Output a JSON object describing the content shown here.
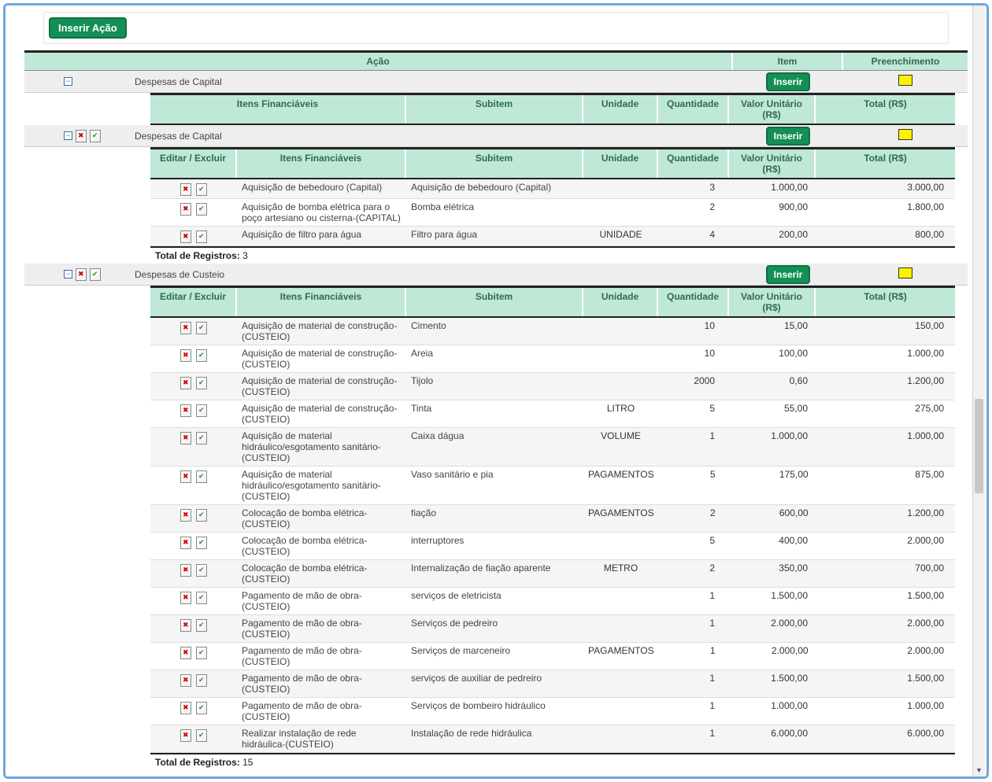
{
  "buttons": {
    "inserir_acao": "Inserir Ação",
    "inserir": "Inserir"
  },
  "headers": {
    "acao": "Ação",
    "item": "Item",
    "preenchimento": "Preenchimento",
    "editar_excluir": "Editar / Excluir",
    "itens_financiaveis": "Itens Financiáveis",
    "subitem": "Subitem",
    "unidade": "Unidade",
    "quantidade": "Quantidade",
    "valor_unitario": "Valor Unitário (R$)",
    "total": "Total (R$)",
    "total_registros": "Total de Registros:"
  },
  "sections": [
    {
      "label": "Despesas de Capital",
      "show_icons": false,
      "rows": [],
      "total": null
    },
    {
      "label": "Despesas de Capital",
      "show_icons": true,
      "rows": [
        {
          "item": "Aquisição de bebedouro (Capital)",
          "sub": "Aquisição de bebedouro (Capital)",
          "unid": "",
          "qtd": "3",
          "valu": "1.000,00",
          "tot": "3.000,00"
        },
        {
          "item": "Aquisição de bomba elétrica para o poço artesiano ou cisterna-(CAPITAL)",
          "sub": "Bomba elétrica",
          "unid": "",
          "qtd": "2",
          "valu": "900,00",
          "tot": "1.800,00"
        },
        {
          "item": "Aquisição de filtro para água",
          "sub": "Filtro para água",
          "unid": "UNIDADE",
          "qtd": "4",
          "valu": "200,00",
          "tot": "800,00"
        }
      ],
      "total": "3"
    },
    {
      "label": "Despesas de Custeio",
      "show_icons": true,
      "rows": [
        {
          "item": "Aquisição de material de construção-(CUSTEIO)",
          "sub": "Cimento",
          "unid": "",
          "qtd": "10",
          "valu": "15,00",
          "tot": "150,00"
        },
        {
          "item": "Aquisição de material de construção-(CUSTEIO)",
          "sub": "Areia",
          "unid": "",
          "qtd": "10",
          "valu": "100,00",
          "tot": "1.000,00"
        },
        {
          "item": "Aquisição de material de construção-(CUSTEIO)",
          "sub": "Tijolo",
          "unid": "",
          "qtd": "2000",
          "valu": "0,60",
          "tot": "1.200,00"
        },
        {
          "item": "Aquisição de material de construção-(CUSTEIO)",
          "sub": "Tinta",
          "unid": "LITRO",
          "qtd": "5",
          "valu": "55,00",
          "tot": "275,00"
        },
        {
          "item": "Aquisição de material hidráulico/esgotamento sanitário-(CUSTEIO)",
          "sub": "Caixa dágua",
          "unid": "VOLUME",
          "qtd": "1",
          "valu": "1.000,00",
          "tot": "1.000,00"
        },
        {
          "item": "Aquisição de material hidráulico/esgotamento sanitário-(CUSTEIO)",
          "sub": "Vaso sanitário e pia",
          "unid": "PAGAMENTOS",
          "qtd": "5",
          "valu": "175,00",
          "tot": "875,00"
        },
        {
          "item": "Colocação de bomba elétrica-(CUSTEIO)",
          "sub": "fiação",
          "unid": "PAGAMENTOS",
          "qtd": "2",
          "valu": "600,00",
          "tot": "1.200,00"
        },
        {
          "item": "Colocação de bomba elétrica-(CUSTEIO)",
          "sub": "interruptores",
          "unid": "",
          "qtd": "5",
          "valu": "400,00",
          "tot": "2.000,00"
        },
        {
          "item": "Colocação de bomba elétrica-(CUSTEIO)",
          "sub": "Internalização de fiação aparente",
          "unid": "METRO",
          "qtd": "2",
          "valu": "350,00",
          "tot": "700,00"
        },
        {
          "item": "Pagamento de mão de obra-(CUSTEIO)",
          "sub": "serviços de eletricista",
          "unid": "",
          "qtd": "1",
          "valu": "1.500,00",
          "tot": "1.500,00"
        },
        {
          "item": "Pagamento de mão de obra-(CUSTEIO)",
          "sub": "Serviços de pedreiro",
          "unid": "",
          "qtd": "1",
          "valu": "2.000,00",
          "tot": "2.000,00"
        },
        {
          "item": "Pagamento de mão de obra-(CUSTEIO)",
          "sub": "Serviços de marceneiro",
          "unid": "PAGAMENTOS",
          "qtd": "1",
          "valu": "2.000,00",
          "tot": "2.000,00"
        },
        {
          "item": "Pagamento de mão de obra-(CUSTEIO)",
          "sub": "serviços de auxiliar de pedreiro",
          "unid": "",
          "qtd": "1",
          "valu": "1.500,00",
          "tot": "1.500,00"
        },
        {
          "item": "Pagamento de mão de obra-(CUSTEIO)",
          "sub": "Serviços de bombeiro hidráulico",
          "unid": "",
          "qtd": "1",
          "valu": "1.000,00",
          "tot": "1.000,00"
        },
        {
          "item": "Realizar instalação de rede hidráulica-(CUSTEIO)",
          "sub": "Instalação de rede hidráulica",
          "unid": "",
          "qtd": "1",
          "valu": "6.000,00",
          "tot": "6.000,00"
        }
      ],
      "total": "15"
    }
  ]
}
